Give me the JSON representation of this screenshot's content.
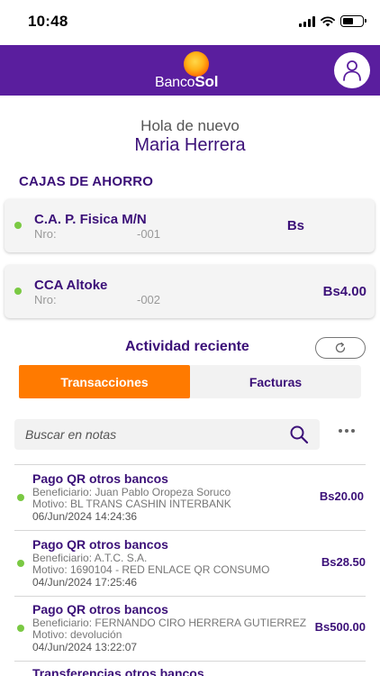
{
  "status_bar": {
    "time": "10:48"
  },
  "header": {
    "brand_first": "Banco",
    "brand_second": "Sol"
  },
  "greeting": {
    "hello": "Hola de nuevo",
    "name": "Maria Herrera"
  },
  "savings": {
    "title": "CAJAS DE AHORRO",
    "accounts": [
      {
        "name": "C.A. P. Fisica M/N",
        "nro_label": "Nro:",
        "nro": "-001",
        "balance": "Bs"
      },
      {
        "name": "CCA Altoke",
        "nro_label": "Nro:",
        "nro": "-002",
        "balance": "Bs4.00"
      }
    ]
  },
  "activity": {
    "title": "Actividad reciente",
    "tabs": [
      {
        "label": "Transacciones",
        "active": true
      },
      {
        "label": "Facturas",
        "active": false
      }
    ],
    "search_placeholder": "Buscar en notas"
  },
  "transactions": [
    {
      "title": "Pago QR otros bancos",
      "beneficiary": "Beneficiario: Juan Pablo Oropeza Soruco",
      "motive": "Motivo: BL TRANS CASHIN INTERBANK",
      "date": "06/Jun/2024 14:24:36",
      "amount": "Bs20.00"
    },
    {
      "title": "Pago QR otros bancos",
      "beneficiary": "Beneficiario: A.T.C. S.A.",
      "motive": "Motivo: 1690104 - RED ENLACE QR CONSUMO",
      "date": "04/Jun/2024 17:25:46",
      "amount": "Bs28.50"
    },
    {
      "title": "Pago QR otros bancos",
      "beneficiary": "Beneficiario: FERNANDO CIRO HERRERA GUTIERREZ",
      "motive": "Motivo: devolución",
      "date": "04/Jun/2024 13:22:07",
      "amount": "Bs500.00"
    },
    {
      "title": "Transferencias otros bancos"
    }
  ],
  "icons": {
    "user": "user-icon",
    "refresh": "refresh-icon",
    "search": "search-icon",
    "more": "more-horizontal-icon",
    "signal": "signal-icon",
    "wifi": "wifi-icon",
    "battery": "battery-icon"
  },
  "colors": {
    "header": "#5a1e9e",
    "accent": "#ff7a00",
    "primary_text": "#3b1078",
    "status_dot": "#7ac943"
  }
}
